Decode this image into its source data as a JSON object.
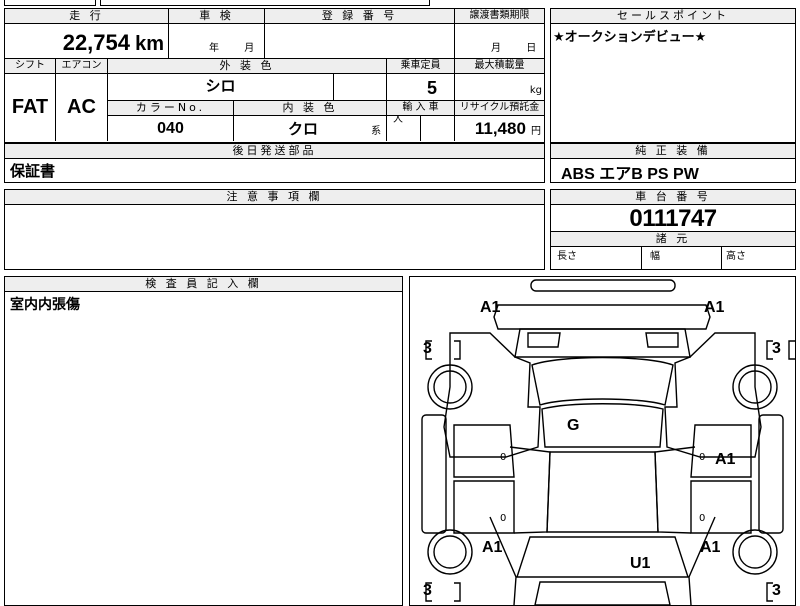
{
  "header": {
    "mileage_label": "走 行",
    "inspection_label": "車 検",
    "registration_label": "登 録 番 号",
    "transfer_label": "譲渡書類期限",
    "sales_point_label": "セールスポイント"
  },
  "values": {
    "mileage": "22,754",
    "mileage_unit": "km",
    "inspection_year": "年",
    "inspection_month": "月",
    "transfer_month": "月",
    "transfer_day": "日",
    "sales_point": "★オークションデビュー★"
  },
  "row2": {
    "shift_label": "シフト",
    "ac_label": "エアコン",
    "exterior_label": "外 装 色",
    "capacity_label": "乗車定員",
    "max_load_label": "最大積載量",
    "shift": "FAT",
    "ac": "AC",
    "exterior": "シロ",
    "capacity": "5",
    "capacity_unit": "人",
    "load_unit": "kg",
    "color_no_label": "カラーNo.",
    "interior_label": "内 装 色",
    "import_label": "輸 入 車",
    "recycle_label": "リサイクル預託金",
    "color_no": "040",
    "interior": "クロ",
    "interior_suffix": "系",
    "recycle": "11,480",
    "recycle_unit": "円"
  },
  "parts": {
    "label": "後日発送部品",
    "value": "保証書"
  },
  "equipment": {
    "label": "純 正 装 備",
    "value": "ABS エアB PS PW"
  },
  "notes": {
    "label": "注 意 事 項 欄"
  },
  "chassis": {
    "label": "車 台 番 号",
    "value": "0111747",
    "dims_label": "諸 元",
    "length": "長さ",
    "width": "幅",
    "height": "高さ"
  },
  "inspector": {
    "label": "検 査 員 記 入 欄",
    "value": "室内内張傷"
  },
  "diagram": {
    "marks": [
      {
        "text": "A1",
        "pos": "front-left"
      },
      {
        "text": "A1",
        "pos": "front-right"
      },
      {
        "text": "G",
        "pos": "windshield"
      },
      {
        "text": "A1",
        "pos": "right-front-door"
      },
      {
        "text": "A1",
        "pos": "rear-left"
      },
      {
        "text": "A1",
        "pos": "rear-right"
      },
      {
        "text": "U1",
        "pos": "rear"
      }
    ],
    "tire_marks": [
      "3",
      "3",
      "3",
      "3"
    ],
    "zeros": [
      "0",
      "0",
      "0",
      "0"
    ]
  }
}
